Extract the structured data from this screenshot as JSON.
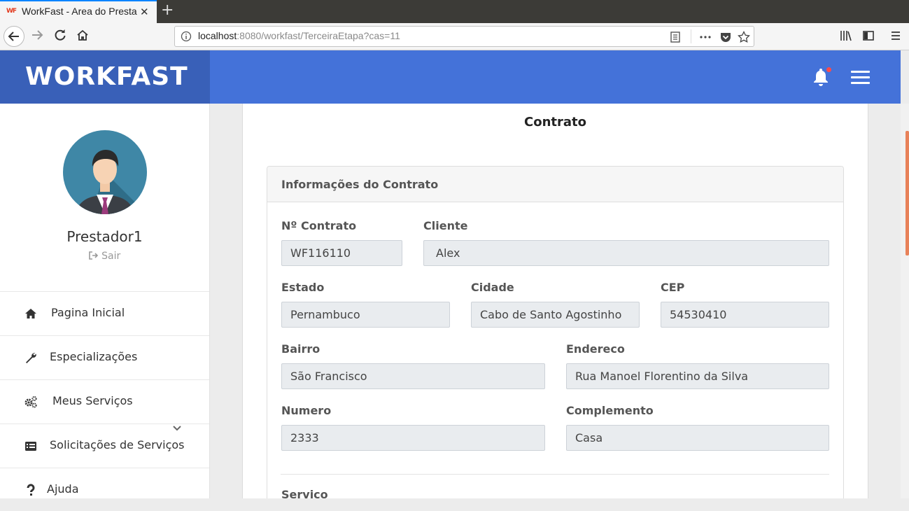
{
  "browser": {
    "tab_title": "WorkFast - Area do Prestador",
    "favicon_text": "WF",
    "url_host": "localhost",
    "url_rest": ":8080/workfast/TerceiraEtapa?cas=11"
  },
  "header": {
    "brand": "WORKFAST",
    "colors": {
      "brand_bg": "#3960b8",
      "topbar_bg": "#4472d9",
      "notification_dot": "#ff4b4b"
    }
  },
  "sidebar": {
    "user_name": "Prestador1",
    "logout_label": "Sair",
    "items": [
      {
        "label": "Pagina Inicial",
        "icon": "home-icon"
      },
      {
        "label": "Especializações",
        "icon": "wrench-icon"
      },
      {
        "label": "Meus Serviços",
        "icon": "gears-icon"
      },
      {
        "label": "Solicitações de Serviços",
        "icon": "list-icon"
      },
      {
        "label": "Ajuda",
        "icon": "question-icon"
      }
    ]
  },
  "main": {
    "title": "Contrato",
    "panel_title": "Informações do Contrato",
    "fields": {
      "contrato": {
        "label": "Nº Contrato",
        "value": "WF116110"
      },
      "cliente": {
        "label": "Cliente",
        "value": "Alex"
      },
      "estado": {
        "label": "Estado",
        "value": "Pernambuco"
      },
      "cidade": {
        "label": "Cidade",
        "value": "Cabo de Santo Agostinho"
      },
      "cep": {
        "label": "CEP",
        "value": "54530410"
      },
      "bairro": {
        "label": "Bairro",
        "value": "São Francisco"
      },
      "endereco": {
        "label": "Endereco",
        "value": "Rua Manoel Florentino da Silva"
      },
      "numero": {
        "label": "Numero",
        "value": "2333"
      },
      "complemento": {
        "label": "Complemento",
        "value": "Casa"
      }
    },
    "next_section_label": "Servico"
  }
}
